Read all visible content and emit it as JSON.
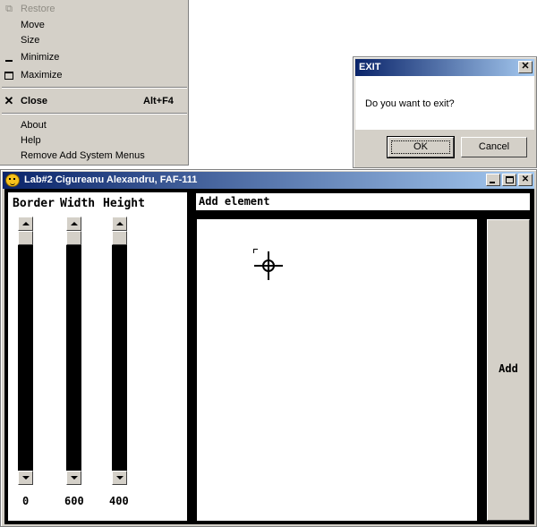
{
  "system_menu": {
    "items": [
      {
        "label": "Restore",
        "icon": "restore-icon",
        "disabled": true
      },
      {
        "label": "Move"
      },
      {
        "label": "Size"
      },
      {
        "label": "Minimize",
        "icon": "minimize-icon"
      },
      {
        "label": "Maximize",
        "icon": "maximize-icon"
      },
      {
        "label": "Close",
        "icon": "close-icon",
        "shortcut": "Alt+F4",
        "bold": true
      },
      {
        "label": "About"
      },
      {
        "label": "Help"
      },
      {
        "label": "Remove Add System Menus"
      }
    ]
  },
  "exit_dialog": {
    "title": "EXIT",
    "close_glyph": "✕",
    "message": "Do you want to exit?",
    "ok_label": "OK",
    "cancel_label": "Cancel"
  },
  "main_window": {
    "title": "Lab#2 Cigureanu Alexandru, FAF-111",
    "controls": {
      "close_glyph": "✕"
    },
    "columns": [
      {
        "label": "Border",
        "value": "0"
      },
      {
        "label": "Width",
        "value": "600"
      },
      {
        "label": "Height",
        "value": "400"
      }
    ],
    "add_element_text": "Add element",
    "add_button_label": "Add"
  },
  "colors": {
    "titlebar_start": "#0a246a",
    "titlebar_end": "#a6caf0",
    "face": "#d4d0c8"
  }
}
